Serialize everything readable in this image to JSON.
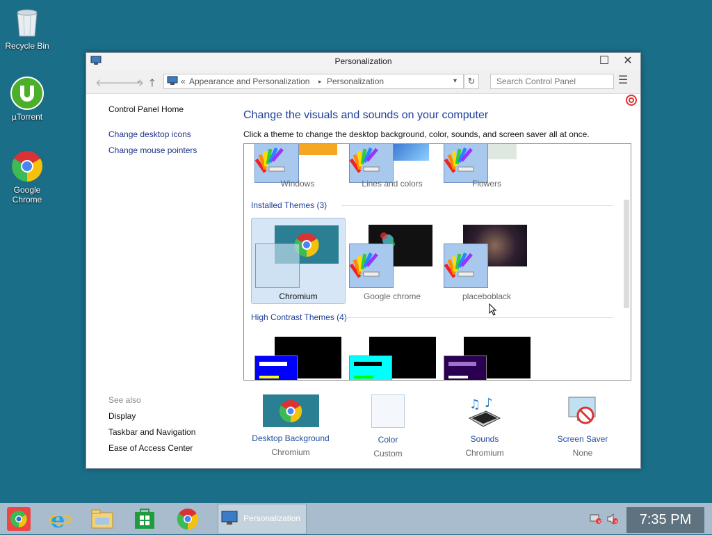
{
  "desktop": {
    "icons": [
      {
        "label": "Recycle Bin"
      },
      {
        "label": "µTorrent"
      },
      {
        "label": "Google Chrome"
      }
    ]
  },
  "window": {
    "title": "Personalization",
    "breadcrumb": {
      "prefix": "«",
      "item1": "Appearance and Personalization",
      "item2": "Personalization"
    },
    "search_placeholder": "Search Control Panel"
  },
  "left_pane": {
    "home": "Control Panel Home",
    "links": [
      "Change desktop icons",
      "Change mouse pointers"
    ],
    "see_also_title": "See also",
    "see_also": [
      "Display",
      "Taskbar and Navigation",
      "Ease of Access Center"
    ]
  },
  "main": {
    "heading": "Change the visuals and sounds on your computer",
    "subheading": "Click a theme to change the desktop background, color, sounds, and screen saver all at once.",
    "top_themes": [
      "Windows",
      "Lines and colors",
      "Flowers"
    ],
    "installed_title": "Installed Themes (3)",
    "installed": [
      "Chromium",
      "Google chrome",
      "placeboblack"
    ],
    "selected_theme": "Chromium",
    "high_contrast_title": "High Contrast Themes (4)"
  },
  "footer": [
    {
      "label": "Desktop Background",
      "value": "Chromium"
    },
    {
      "label": "Color",
      "value": "Custom"
    },
    {
      "label": "Sounds",
      "value": "Chromium"
    },
    {
      "label": "Screen Saver",
      "value": "None"
    }
  ],
  "taskbar": {
    "active_label": "Personalization",
    "time": "7:35 PM"
  },
  "colors": {
    "desktop": "#1a6e88",
    "link": "#1e3287",
    "heading": "#1e3f9a"
  }
}
